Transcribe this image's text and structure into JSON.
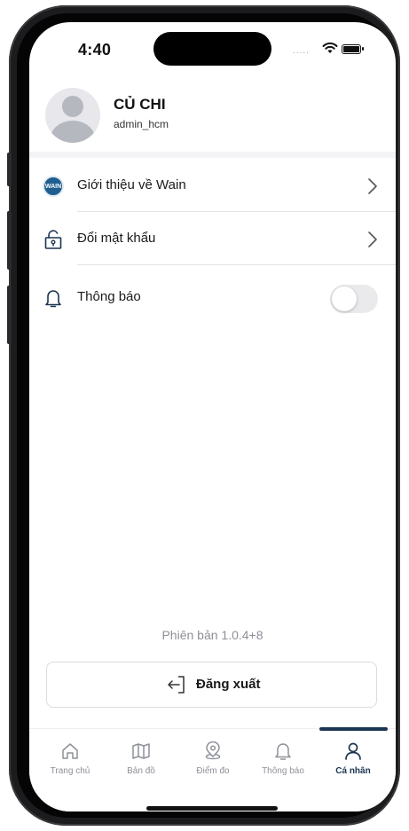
{
  "status": {
    "time": "4:40",
    "signal": "....."
  },
  "profile": {
    "name": "CỦ CHI",
    "username": "admin_hcm"
  },
  "menu": [
    {
      "label": "Giới thiệu về Wain",
      "icon": "wain-logo-icon"
    },
    {
      "label": "Đổi mật khẩu",
      "icon": "lock-icon"
    },
    {
      "label": "Thông báo",
      "icon": "bell-icon",
      "toggle_on": false
    }
  ],
  "wain_badge": "WAIN",
  "version": "Phiên bản 1.0.4+8",
  "logout": {
    "label": "Đăng xuất"
  },
  "tabs": [
    {
      "label": "Trang chủ",
      "icon": "home-icon"
    },
    {
      "label": "Bản đồ",
      "icon": "map-icon"
    },
    {
      "label": "Điểm đo",
      "icon": "location-pin-icon"
    },
    {
      "label": "Thông báo",
      "icon": "bell-icon"
    },
    {
      "label": "Cá nhân",
      "icon": "user-icon",
      "active": true
    }
  ],
  "colors": {
    "accent": "#1b3552",
    "inactive": "#8e9099",
    "wain": "#1f5e8f"
  }
}
